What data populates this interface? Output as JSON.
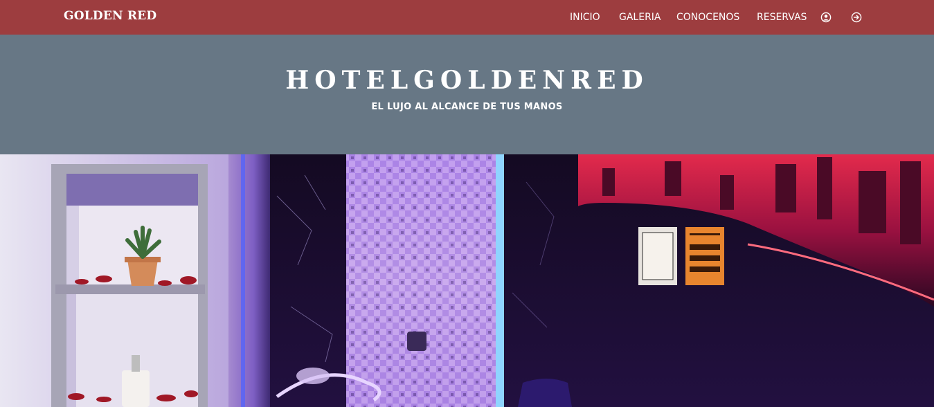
{
  "navbar": {
    "brand": "GOLDEN RED",
    "links": [
      "INICIO",
      "GALERIA",
      "CONOCENOS",
      "RESERVAS"
    ],
    "icons": [
      "user-circle-icon",
      "login-arrow-icon"
    ],
    "color": "#9d3d3f"
  },
  "header": {
    "title": "HOTELGOLDENRED",
    "subtitle": "EL LUJO AL ALCANCE DE TUS MANOS",
    "color": "#677785"
  }
}
